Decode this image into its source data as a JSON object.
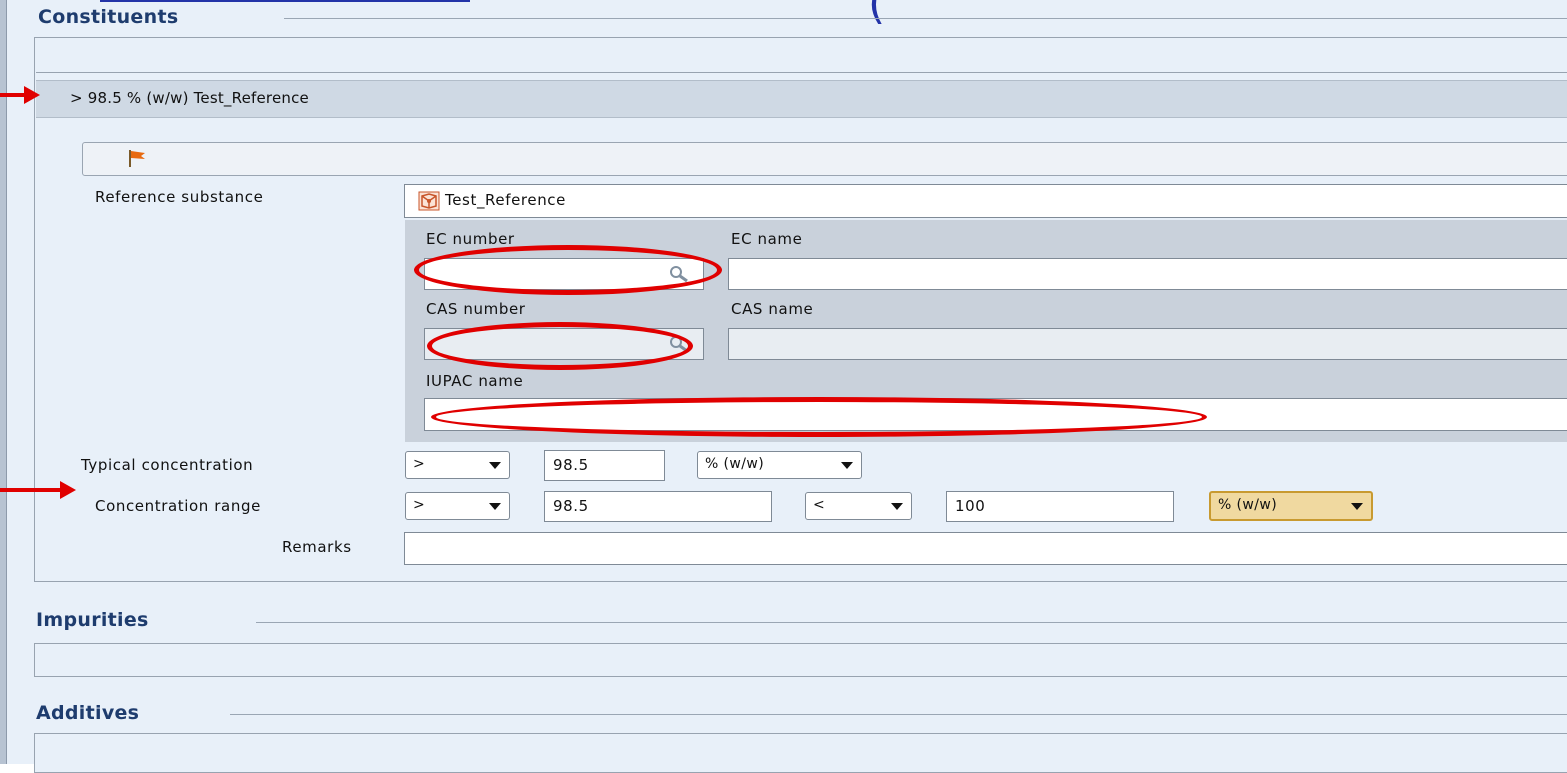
{
  "top_partial_text": "(",
  "sections": {
    "constituents": "Constituents",
    "impurities": "Impurities",
    "additives": "Additives"
  },
  "constituent": {
    "header": "> 98.5 % (w/w) Test_Reference",
    "reference_substance_label": "Reference substance",
    "reference_substance_value": "Test_Reference",
    "ec_number_label": "EC number",
    "ec_name_label": "EC name",
    "cas_number_label": "CAS number",
    "cas_name_label": "CAS name",
    "iupac_name_label": "IUPAC name",
    "typical_concentration_label": "Typical concentration",
    "typical_qualifier": ">",
    "typical_value": "98.5",
    "typical_unit": "% (w/w)",
    "concentration_range_label": "Concentration range",
    "range_lower_qualifier": ">",
    "range_lower_value": "98.5",
    "range_upper_qualifier": "<",
    "range_upper_value": "100",
    "range_unit": "% (w/w)",
    "remarks_label": "Remarks",
    "remarks_value": ""
  },
  "colors": {
    "panel_bg": "#e8f0f9",
    "section_title": "#1e3c6e",
    "annotation_red": "#e00000",
    "unit_highlight": "#f0d9a0"
  }
}
